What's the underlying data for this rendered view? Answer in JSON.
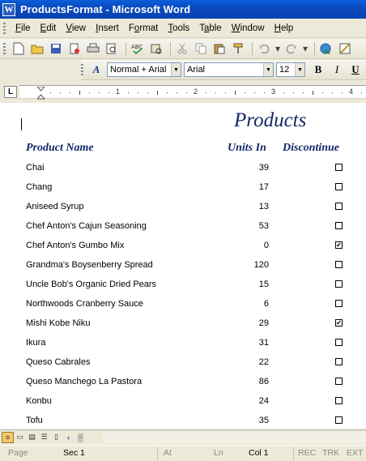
{
  "window": {
    "title": "ProductsFormat - Microsoft Word",
    "app_icon": "W"
  },
  "menu": [
    {
      "label": "File",
      "key": "F"
    },
    {
      "label": "Edit",
      "key": "E"
    },
    {
      "label": "View",
      "key": "V"
    },
    {
      "label": "Insert",
      "key": "I"
    },
    {
      "label": "Format",
      "key": "o"
    },
    {
      "label": "Tools",
      "key": "T"
    },
    {
      "label": "Table",
      "key": "a"
    },
    {
      "label": "Window",
      "key": "W"
    },
    {
      "label": "Help",
      "key": "H"
    }
  ],
  "formatting": {
    "style": "Normal + Arial",
    "font": "Arial",
    "size": "12",
    "bold_label": "B",
    "italic_label": "I",
    "underline_label": "U",
    "styles_icon_label": "A"
  },
  "ruler": {
    "labels": [
      "1",
      "2",
      "3",
      "4"
    ],
    "tab_selector": "L"
  },
  "document": {
    "title": "Products",
    "headers": {
      "product": "Product Name",
      "units": "Units In",
      "discontinued": "Discontinue"
    },
    "rows": [
      {
        "name": "Chai",
        "units": "39",
        "disc": false
      },
      {
        "name": "Chang",
        "units": "17",
        "disc": false
      },
      {
        "name": "Aniseed Syrup",
        "units": "13",
        "disc": false
      },
      {
        "name": "Chef Anton's Cajun Seasoning",
        "units": "53",
        "disc": false
      },
      {
        "name": "Chef Anton's Gumbo Mix",
        "units": "0",
        "disc": true
      },
      {
        "name": "Grandma's Boysenberry Spread",
        "units": "120",
        "disc": false
      },
      {
        "name": "Uncle Bob's Organic Dried Pears",
        "units": "15",
        "disc": false
      },
      {
        "name": "Northwoods Cranberry Sauce",
        "units": "6",
        "disc": false
      },
      {
        "name": "Mishi Kobe Niku",
        "units": "29",
        "disc": true
      },
      {
        "name": "Ikura",
        "units": "31",
        "disc": false
      },
      {
        "name": "Queso Cabrales",
        "units": "22",
        "disc": false
      },
      {
        "name": "Queso Manchego La Pastora",
        "units": "86",
        "disc": false
      },
      {
        "name": "Konbu",
        "units": "24",
        "disc": false
      },
      {
        "name": "Tofu",
        "units": "35",
        "disc": false
      }
    ]
  },
  "status": {
    "page": "Page",
    "sec": "Sec  1",
    "at": "At",
    "ln": "Ln",
    "col": "Col  1",
    "rec": "REC",
    "trk": "TRK",
    "ext": "EXT"
  }
}
